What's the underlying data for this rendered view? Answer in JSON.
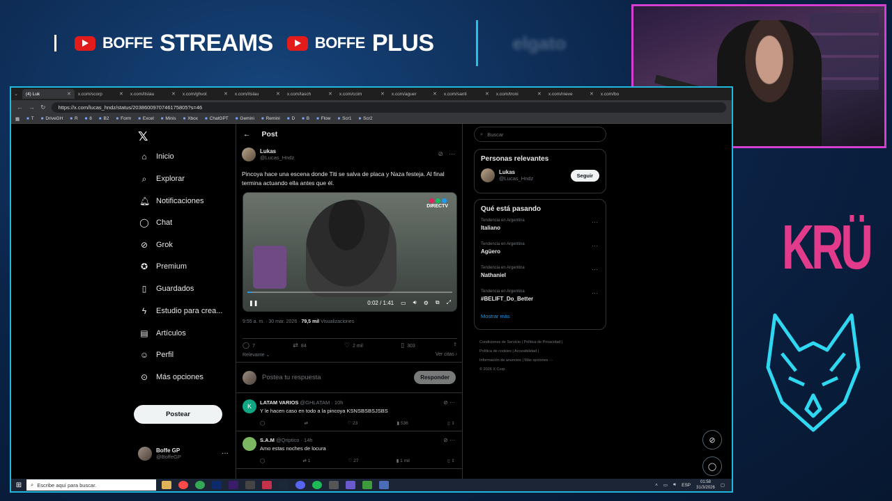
{
  "overlay": {
    "boffe1": "BOFFE",
    "streams": "STREAMS",
    "boffe2": "BOFFE",
    "plus": "PLUS",
    "sponsor": "elgato",
    "kru": "KRÜ"
  },
  "browser": {
    "tabs": [
      {
        "label": "(4) Luk",
        "active": true
      },
      {
        "label": "x.com/scorp",
        "active": false
      },
      {
        "label": "x.com/itslau",
        "active": false
      },
      {
        "label": "x.com/ghvol",
        "active": false
      },
      {
        "label": "x.com/itslau",
        "active": false
      },
      {
        "label": "x.com/lasch",
        "active": false
      },
      {
        "label": "x.com/ccim",
        "active": false
      },
      {
        "label": "x.com/aguer",
        "active": false
      },
      {
        "label": "x.com/santi",
        "active": false
      },
      {
        "label": "x.com/troni",
        "active": false
      },
      {
        "label": "x.com/nieve",
        "active": false
      },
      {
        "label": "x.com/bo",
        "active": false
      }
    ],
    "url": "https://x.com/lucas_hndz/status/2038600970746175805?s=46",
    "bookmarks": [
      "T",
      "DriveGH",
      "R",
      "8",
      "B2",
      "Form",
      "Excel",
      "Minis",
      "Xbox",
      "ChatGPT",
      "Gemini",
      "Remini",
      "D",
      "B",
      "Flow",
      "Scr1",
      "Scr2"
    ]
  },
  "nav": {
    "items": [
      "Inicio",
      "Explorar",
      "Notificaciones",
      "Chat",
      "Grok",
      "Premium",
      "Guardados",
      "Estudio para crea...",
      "Artículos",
      "Perfil",
      "Más opciones"
    ],
    "post_button": "Postear",
    "me_name": "Boffe GP",
    "me_handle": "@BoffeGP"
  },
  "post": {
    "header": "Post",
    "author": "Lukas",
    "handle": "@Lucas_Hndz",
    "text": "Pincoya hace una escena donde Titi se salva de placa y Naza festeja. Al final termina actuando ella antes que él.",
    "video_brand": "DIRECTV",
    "video_time": "0:02 / 1:41",
    "video_progress": 0.02,
    "timestamp": "9:55 a. m. · 30 mar. 2026 · ",
    "views": "79,5 mil",
    "views_label": " Visualizaciones",
    "replies": "7",
    "reposts": "84",
    "likes": "2 mil",
    "bookmarks": "303",
    "sort": "Relevante",
    "quotes": "Ver citas",
    "reply_placeholder": "Postea tu respuesta",
    "reply_button": "Responder"
  },
  "replies": [
    {
      "name": "LATAM VARIOS",
      "handle": "@GHLATAM · 10h",
      "text": "Y le hacen caso en todo a la pincoya KSNSBSBSJSBS",
      "reposts": "",
      "likes": "23",
      "views": "536",
      "avatar_letter": "K",
      "avatar_color": "#11a683"
    },
    {
      "name": "S.A.M",
      "handle": "@Qriptico · 14h",
      "text": "Amo estas noches de locura",
      "reposts": "1",
      "likes": "27",
      "views": "1 mil",
      "avatar_letter": "",
      "avatar_color": "#7bb661"
    }
  ],
  "right": {
    "search_placeholder": "Buscar",
    "relevant_title": "Personas relevantes",
    "rel_name": "Lukas",
    "rel_handle": "@Lucas_Hndz",
    "follow": "Seguir",
    "trends_title": "Qué está pasando",
    "trends": [
      {
        "ctx": "Tendencia en Argentina",
        "name": "Italiano"
      },
      {
        "ctx": "Tendencia en Argentina",
        "name": "Agüero"
      },
      {
        "ctx": "Tendencia en Argentina",
        "name": "Nathaniel"
      },
      {
        "ctx": "Tendencia en Argentina",
        "name": "#BELIFT_Do_Better"
      }
    ],
    "show_more": "Mostrar más",
    "footer1": "Condiciones de Servicio  |  Política de Privacidad  |",
    "footer2": "Política de cookies  |  Accesibilidad  |",
    "footer3": "Información de anuncios  |  Más opciones ···",
    "footer4": "© 2026 X Corp."
  },
  "taskbar": {
    "search": "Escribe aquí para buscar.",
    "lang": "ESP",
    "time": "01:58",
    "date": "31/3/2026"
  }
}
